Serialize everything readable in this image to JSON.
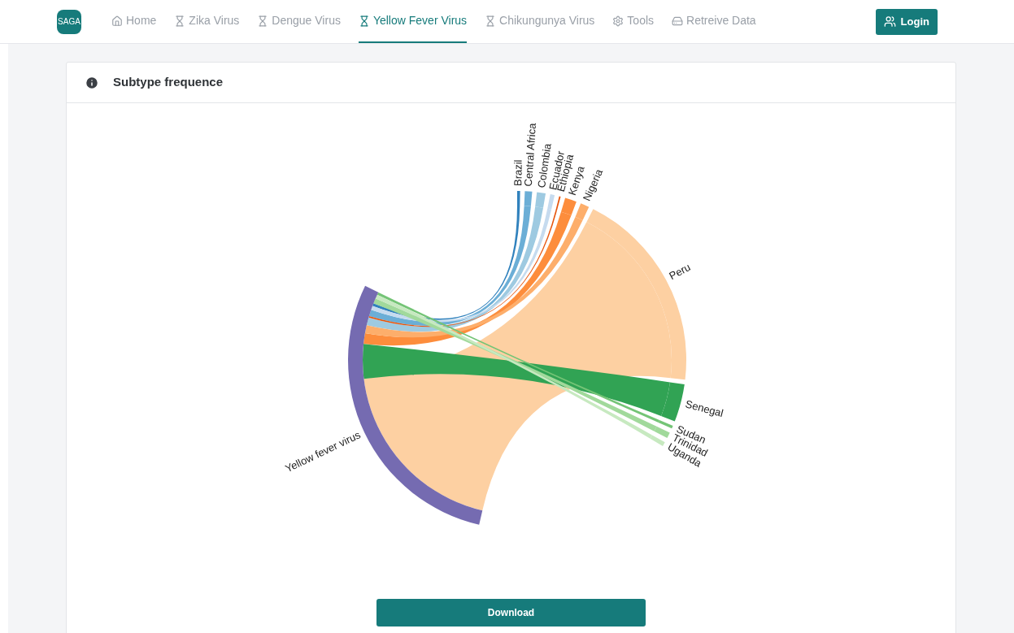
{
  "nav": {
    "logo": "SAGA",
    "items": [
      {
        "label": "Home",
        "kind": "home",
        "selected": false
      },
      {
        "label": "Zika Virus",
        "kind": "virus",
        "selected": false
      },
      {
        "label": "Dengue Virus",
        "kind": "virus",
        "selected": false
      },
      {
        "label": "Yellow Fever Virus",
        "kind": "virus",
        "selected": true
      },
      {
        "label": "Chikungunya Virus",
        "kind": "virus",
        "selected": false
      },
      {
        "label": "Tools",
        "kind": "tools",
        "selected": false
      },
      {
        "label": "Retreive Data",
        "kind": "data",
        "selected": false
      }
    ],
    "login": "Login"
  },
  "card": {
    "title": "Subtype frequence",
    "chart": {
      "source": {
        "label": "Yellow fever virus",
        "color": "#756bb1"
      },
      "groups": [
        {
          "label": "Brazil",
          "color": "#3182bd"
        },
        {
          "label": "Central Africa",
          "color": "#6baed6"
        },
        {
          "label": "Colombia",
          "color": "#9ecae1"
        },
        {
          "label": "Ecuador",
          "color": "#c6dbef"
        },
        {
          "label": "Ethiopia",
          "color": "#e6550d"
        },
        {
          "label": "Kenya",
          "color": "#fd8d3c"
        },
        {
          "label": "Nigeria",
          "color": "#fdae6b"
        },
        {
          "label": "Peru",
          "color": "#fdd0a2"
        },
        {
          "label": "Senegal",
          "color": "#31a354"
        },
        {
          "label": "Sudan",
          "color": "#74c476"
        },
        {
          "label": "Trinidad",
          "color": "#a1d99b"
        },
        {
          "label": "Uganda",
          "color": "#c7e9c0"
        }
      ]
    },
    "download": "Download"
  }
}
